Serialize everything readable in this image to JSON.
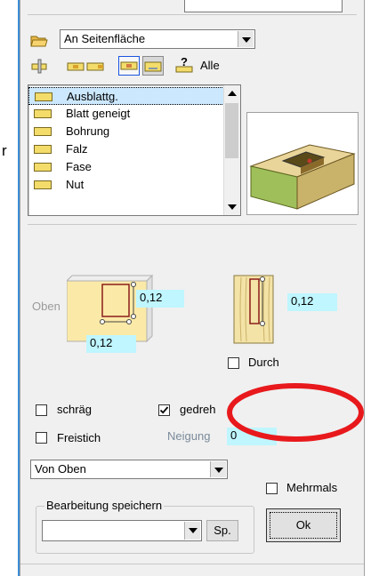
{
  "left_edge_text": "r",
  "position_combo": {
    "value": "An Seitenfläche"
  },
  "toolbar": {
    "alle_label": "Alle",
    "help_glyph": "?"
  },
  "machining_list": {
    "items": [
      {
        "label": "Ausblattg.",
        "selected": true
      },
      {
        "label": "Blatt geneigt",
        "selected": false
      },
      {
        "label": "Bohrung",
        "selected": false
      },
      {
        "label": "Falz",
        "selected": false
      },
      {
        "label": "Fase",
        "selected": false
      },
      {
        "label": "Nut",
        "selected": false
      }
    ]
  },
  "dimensions": {
    "oben_label": "Oben",
    "top_width": "0,12",
    "top_depth": "0,12",
    "side_value": "0,12"
  },
  "options": {
    "durch_label": "Durch",
    "durch_checked": false,
    "schraeg_label": "schräg",
    "schraeg_checked": false,
    "gedreht_label": "gedreh",
    "gedreht_checked": true,
    "freistich_label": "Freistich",
    "freistich_checked": false,
    "neigung_label": "Neigung",
    "neigung_value": "0"
  },
  "direction_combo": {
    "value": "Von Oben"
  },
  "mehrmals": {
    "label": "Mehrmals",
    "checked": false
  },
  "save_group": {
    "title": "Bearbeitung speichern",
    "combo_value": "",
    "sp_label": "Sp."
  },
  "ok_label": "Ok",
  "colors": {
    "highlight_ellipse": "#e8191c",
    "value_bg": "#bff6ff",
    "selection": "#cce8ff"
  }
}
